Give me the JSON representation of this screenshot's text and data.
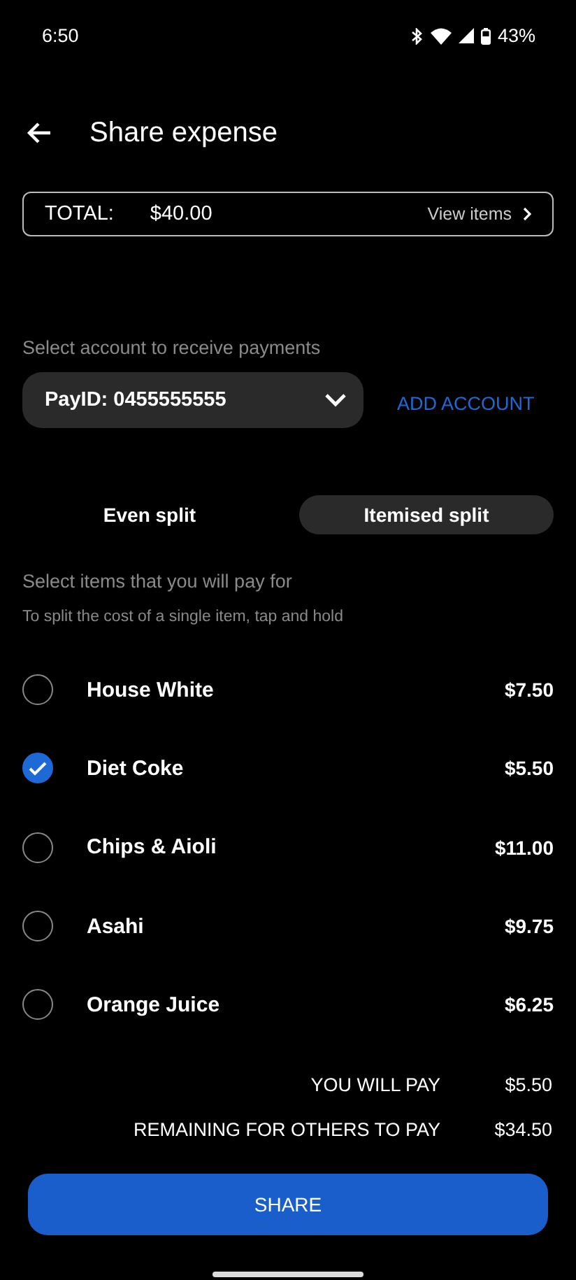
{
  "status_bar": {
    "time": "6:50",
    "battery": "43%"
  },
  "header": {
    "title": "Share expense"
  },
  "total": {
    "label": "TOTAL:",
    "amount": "$40.00",
    "link": "View items"
  },
  "account": {
    "label": "Select account to receive payments",
    "value": "PayID: 0455555555",
    "add": "ADD ACCOUNT"
  },
  "tabs": [
    {
      "label": "Even split",
      "selected": false
    },
    {
      "label": "Itemised split",
      "selected": true
    }
  ],
  "items_label": "Select items that you will pay for",
  "items_hint": "To split the cost of a single item, tap and hold",
  "items": [
    {
      "name": "House White",
      "price": "$7.50",
      "checked": false
    },
    {
      "name": "Diet Coke",
      "price": "$5.50",
      "checked": true
    },
    {
      "name": "Chips & Aioli",
      "price": "$11.00",
      "checked": false
    },
    {
      "name": "Asahi",
      "price": "$9.75",
      "checked": false
    },
    {
      "name": "Orange Juice",
      "price": "$6.25",
      "checked": false
    }
  ],
  "summary": [
    {
      "label": "YOU WILL PAY",
      "amount": "$5.50"
    },
    {
      "label": "REMAINING FOR OTHERS TO PAY",
      "amount": "$34.50"
    }
  ],
  "share_button": "SHARE"
}
